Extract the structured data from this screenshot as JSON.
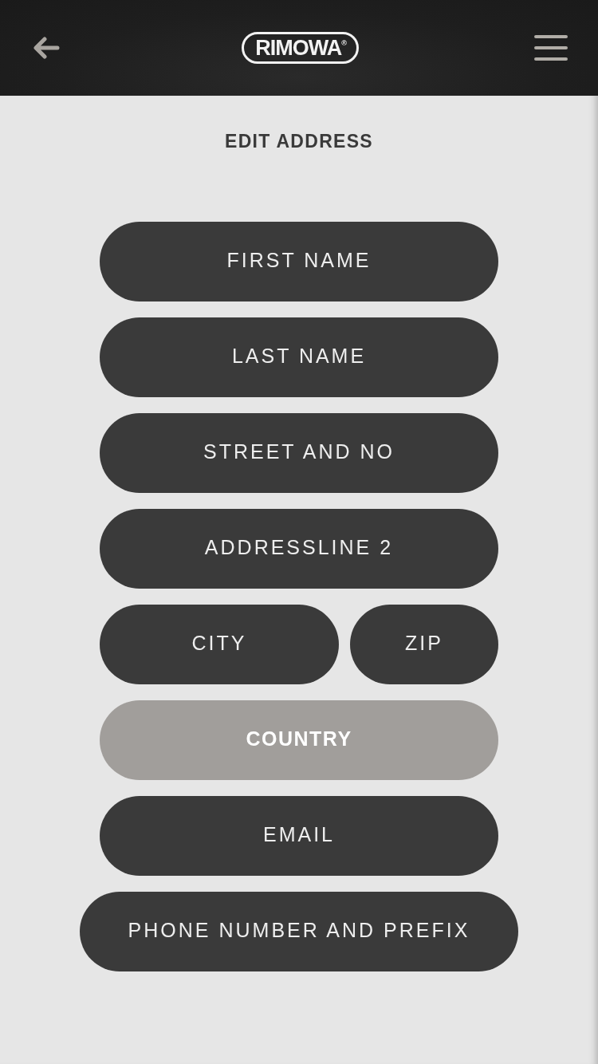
{
  "header": {
    "logo": "RIMOWA$^{®}$"
  },
  "title": "EDIT ADDRESS",
  "form": {
    "rows": [
      {
        "fields": [
          {
            "kind": "input",
            "placeholder": "FIRST NAME"
          }
        ]
      },
      {
        "fields": [
          {
            "kind": "input",
            "placeholder": "LAST NAME"
          }
        ]
      },
      {
        "fields": [
          {
            "kind": "input",
            "placeholder": "STREET AND NO"
          }
        ]
      },
      {
        "fields": [
          {
            "kind": "input",
            "placeholder": "ADDRESSLINE 2"
          }
        ]
      },
      {
        "fields": [
          {
            "kind": "input",
            "placeholder": "CITY"
          },
          {
            "kind": "input",
            "placeholder": "ZIP"
          }
        ]
      },
      {
        "fields": [
          {
            "kind": "select",
            "placeholder": "COUNTRY"
          }
        ]
      },
      {
        "fields": [
          {
            "kind": "input",
            "placeholder": "EMAIL"
          }
        ]
      },
      {
        "fields": [
          {
            "kind": "phone",
            "placeholder": "PHONE NUMBER AND PREFIX"
          }
        ]
      }
    ]
  }
}
